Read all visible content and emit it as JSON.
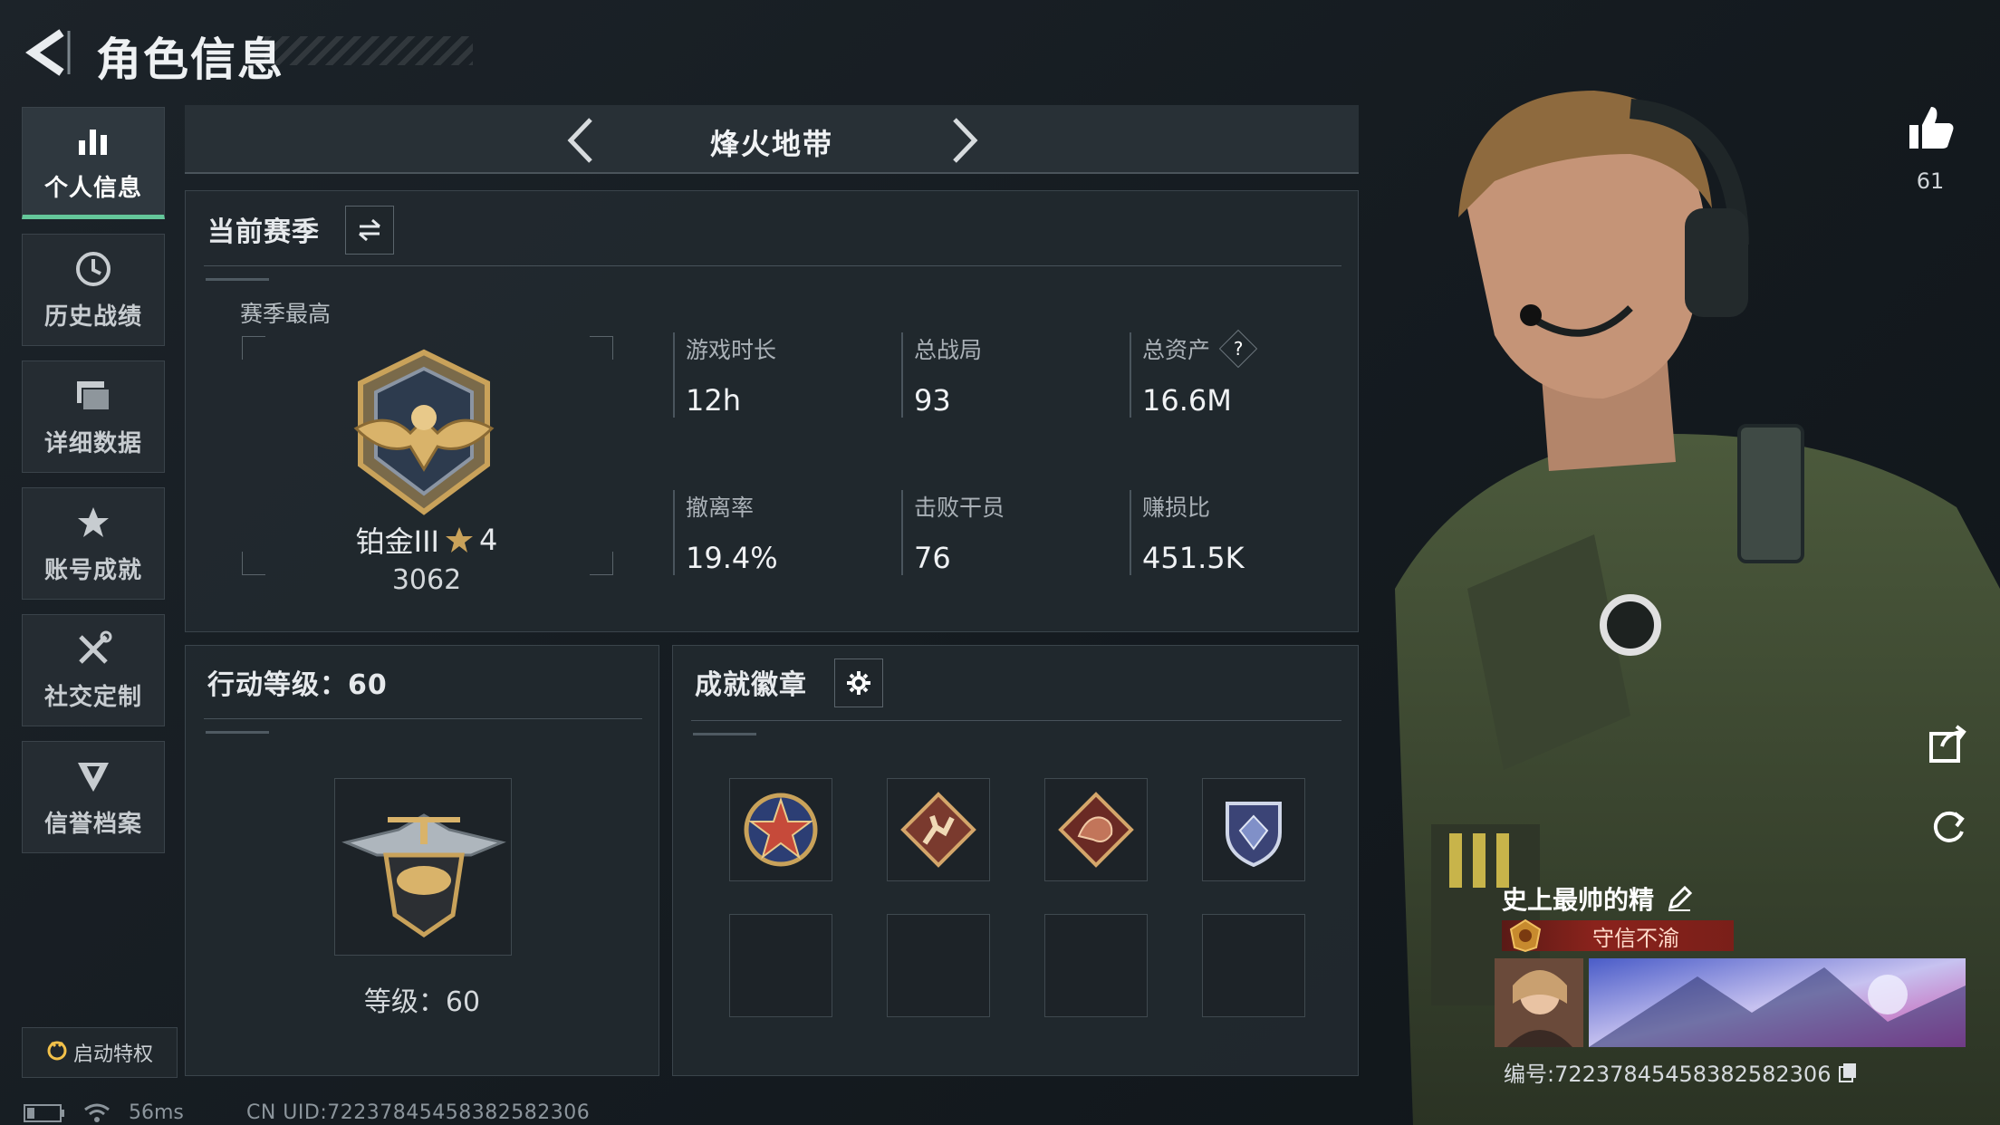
{
  "header": {
    "title": "角色信息"
  },
  "sidebar": {
    "items": [
      {
        "label": "个人信息",
        "icon": "bar-chart-icon",
        "active": true
      },
      {
        "label": "历史战绩",
        "icon": "history-clock-icon",
        "active": false
      },
      {
        "label": "详细数据",
        "icon": "folder-stack-icon",
        "active": false
      },
      {
        "label": "账号成就",
        "icon": "achievement-star-icon",
        "active": false
      },
      {
        "label": "社交定制",
        "icon": "tools-icon",
        "active": false
      },
      {
        "label": "信誉档案",
        "icon": "reputation-shield-icon",
        "active": false
      }
    ],
    "privilege_label": "启动特权"
  },
  "mode": {
    "title": "烽火地带"
  },
  "season": {
    "title": "当前赛季",
    "best_label": "赛季最高",
    "rank_name": "铂金III",
    "rank_stars": "4",
    "rank_points": "3062",
    "stats": [
      {
        "label": "游戏时长",
        "value": "12h"
      },
      {
        "label": "总战局",
        "value": "93"
      },
      {
        "label": "总资产",
        "value": "16.6M",
        "help": "?"
      },
      {
        "label": "撤离率",
        "value": "19.4%"
      },
      {
        "label": "击败干员",
        "value": "76"
      },
      {
        "label": "赚损比",
        "value": "451.5K"
      }
    ]
  },
  "action_level": {
    "title": "行动等级：60",
    "level_label": "等级：60"
  },
  "achievements": {
    "title": "成就徽章",
    "badges": [
      "star-medal-icon",
      "runner-badge-icon",
      "dragon-badge-icon",
      "crest-shield-icon",
      "",
      "",
      "",
      ""
    ]
  },
  "character": {
    "likes": "61",
    "player_name": "史上最帅的精",
    "title_tag": "守信不渝",
    "id_text": "编号:72237845458382582306"
  },
  "status": {
    "ping": "56ms",
    "uid": "CN UID:72237845458382582306"
  },
  "colors": {
    "accent": "#64c79a",
    "title_tag": "#8a231c",
    "gold": "#c9a25a"
  }
}
